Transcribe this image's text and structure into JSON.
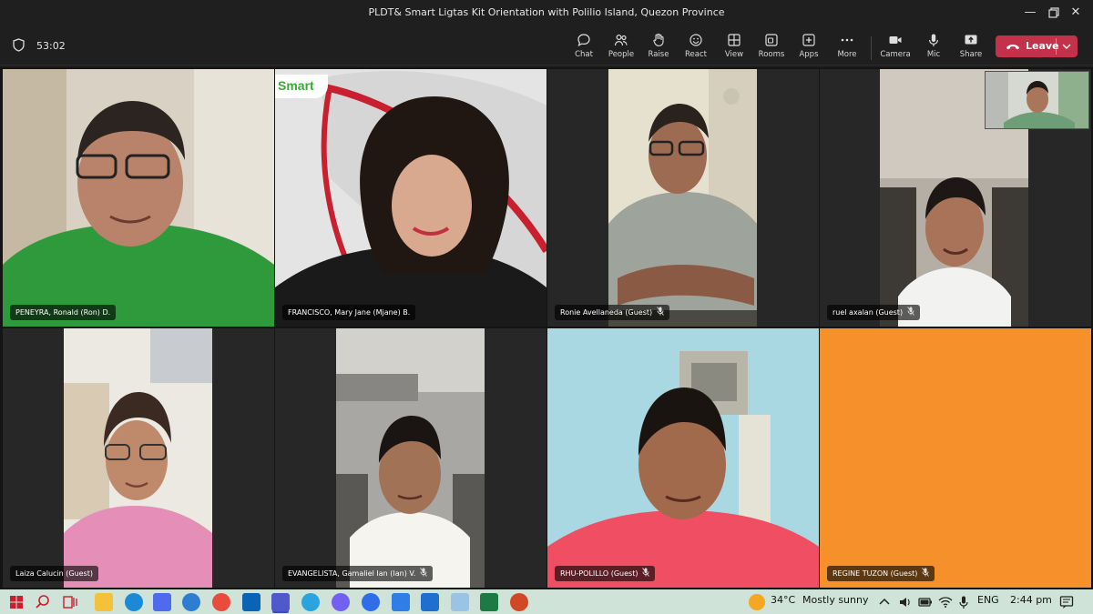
{
  "window": {
    "title": "PLDT& Smart Ligtas Kit Orientation with Polilio Island, Quezon Province",
    "minimize_icon": "minimize-icon",
    "restore_icon": "restore-icon",
    "close_icon": "close-icon"
  },
  "meeting": {
    "timer": "53:02",
    "buttons": [
      {
        "label": "Chat",
        "icon": "chat-icon"
      },
      {
        "label": "People",
        "icon": "people-icon"
      },
      {
        "label": "Raise",
        "icon": "raise-hand-icon"
      },
      {
        "label": "React",
        "icon": "react-icon"
      },
      {
        "label": "View",
        "icon": "view-icon"
      },
      {
        "label": "Rooms",
        "icon": "rooms-icon"
      },
      {
        "label": "Apps",
        "icon": "apps-icon"
      },
      {
        "label": "More",
        "icon": "more-icon"
      },
      {
        "label": "Camera",
        "icon": "camera-icon"
      },
      {
        "label": "Mic",
        "icon": "mic-icon"
      },
      {
        "label": "Share",
        "icon": "share-icon"
      }
    ],
    "leave_label": "Leave",
    "leave_color": "#c4314b"
  },
  "participants": [
    {
      "name": "PENEYRA, Ronald (Ron) D.",
      "muted": false
    },
    {
      "name": "FRANCISCO, Mary Jane (Mjane) B.",
      "muted": false
    },
    {
      "name": "Ronie Avellaneda (Guest)",
      "muted": true
    },
    {
      "name": "ruel axalan (Guest)",
      "muted": true
    },
    {
      "name": "Laiza Calucin (Guest)",
      "muted": false
    },
    {
      "name": "EVANGELISTA, Gamaliel Ian (Ian) V.",
      "muted": true
    },
    {
      "name": "RHU-POLILLO (Guest)",
      "muted": true
    },
    {
      "name": "REGINE TUZON (Guest)",
      "muted": true
    }
  ],
  "backgrounds": {
    "smart_logo_text": "Smart",
    "smart_green": "#3aaa35",
    "placeholder_color": "#f5902a"
  },
  "taskbar": {
    "weather_temp": "34°C",
    "weather_text": "Mostly sunny",
    "language": "ENG",
    "time": "2:44 pm",
    "icons": [
      "start-icon",
      "search-icon",
      "task-view-icon",
      "file-explorer-icon",
      "edge-icon",
      "store-icon",
      "ie-icon",
      "chrome-icon",
      "outlook-icon",
      "teams-icon",
      "telegram-icon",
      "viber-icon",
      "messenger-icon",
      "todo-icon",
      "mail-icon",
      "notepad-icon",
      "excel-icon",
      "powerpoint-icon"
    ]
  }
}
